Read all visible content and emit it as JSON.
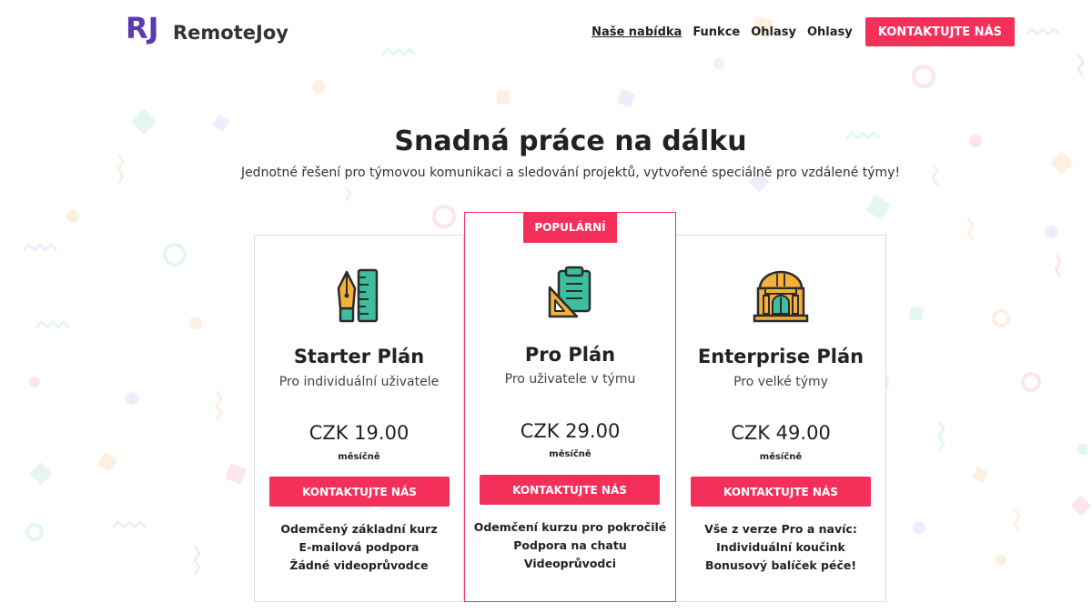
{
  "brand": {
    "logo_letters": "RJ",
    "name": "RemoteJoy",
    "accent_color": "#f4305a",
    "logo_color": "#5b3bb0"
  },
  "nav": {
    "links": [
      "Naše nabídka",
      "Funkce",
      "Ohlasy",
      "Ohlasy"
    ],
    "cta_label": "KONTAKTUJTE NÁS"
  },
  "hero": {
    "title": "Snadná práce na dálku",
    "subtitle": "Jednotné řešení pro týmovou komunikaci a sledování projektů, vytvořené speciálně pro vzdálené týmy!"
  },
  "plans": [
    {
      "icon": "pen-ruler-icon",
      "title": "Starter Plán",
      "description": "Pro individuální uživatele",
      "price": "CZK 19.00",
      "period": "měsíčně",
      "button_label": "KONTAKTUJTE NÁS",
      "features": [
        "Odemčený základní kurz",
        "E-mailová podpora",
        "Žádné videoprůvodce"
      ]
    },
    {
      "badge": "POPULÁRNÍ",
      "icon": "clipboard-icon",
      "title": "Pro Plán",
      "description": "Pro uživatele v týmu",
      "price": "CZK 29.00",
      "period": "měsíčně",
      "button_label": "KONTAKTUJTE NÁS",
      "features": [
        "Odemčení kurzu pro pokročilé",
        "Podpora na chatu",
        "Videoprůvodci"
      ]
    },
    {
      "icon": "building-icon",
      "title": "Enterprise Plán",
      "description": "Pro velké týmy",
      "price": "CZK 49.00",
      "period": "měsíčně",
      "button_label": "KONTAKTUJTE NÁS",
      "features": [
        "Vše z verze Pro a navíc:",
        "Individuální koučink",
        "Bonusový balíček péče!"
      ]
    }
  ]
}
